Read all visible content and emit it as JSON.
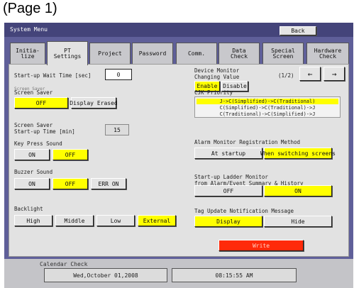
{
  "caption": "(Page 1)",
  "header": {
    "system_menu": "System Menu",
    "back_label": "Back"
  },
  "tabs": [
    {
      "label": "Initia-\nlize",
      "active": false
    },
    {
      "label": "PT\nSettings",
      "active": true
    },
    {
      "label": "Project",
      "active": false
    },
    {
      "label": "Password",
      "active": false
    },
    {
      "label": "Comm.",
      "active": false
    },
    {
      "label": "Data\nCheck",
      "active": false
    },
    {
      "label": "Special\nScreen",
      "active": false
    },
    {
      "label": "Hardware\nCheck",
      "active": false
    }
  ],
  "startup_wait": {
    "label": "Start-up Wait Time [sec]",
    "value": "0"
  },
  "screen_saver": {
    "label_faded": "Screen Saver",
    "label": "Screen Saver",
    "off": "OFF",
    "display_erased": "Display Erased",
    "startup_label": "Screen Saver\nStart-up Time [min]",
    "startup_value": "15"
  },
  "key_press_sound": {
    "label": "Key Press Sound",
    "on": "ON",
    "off": "OFF"
  },
  "buzzer_sound": {
    "label": "Buzzer Sound",
    "on": "ON",
    "off": "OFF",
    "err_on": "ERR ON"
  },
  "backlight": {
    "label": "Backlight",
    "high": "High",
    "middle": "Middle",
    "low": "Low",
    "external": "External"
  },
  "device_monitor": {
    "label": "Device Monitor\nChanging Value",
    "enable": "Enable",
    "disable": "Disable"
  },
  "pager": {
    "text": "(1/2)",
    "prev": "←",
    "next": "→"
  },
  "cjk_priority": {
    "label": "CJK Priority",
    "options": [
      "J->C(Simplified)->C(Traditional)",
      "C(Simplified)->C(Traditional)->J",
      "C(Traditional)->C(Simplified)->J"
    ],
    "selected_index": 0
  },
  "alarm_monitor": {
    "label": "Alarm Monitor Registration Method",
    "at_startup": "At startup",
    "when_switching": "When switching screens"
  },
  "ladder_monitor": {
    "label": "Start-up Ladder Monitor\nfrom Alarm/Event Summary & History",
    "off": "OFF",
    "on": "ON"
  },
  "tag_update": {
    "label": "Tag Update Notification Message",
    "display": "Display",
    "hide": "Hide"
  },
  "write_button": "Write",
  "calendar": {
    "label": "Calendar Check",
    "date": "Wed,October 01,2008",
    "time": "08:15:55 AM"
  },
  "colors": {
    "selected": "#ffff00",
    "write": "#ff2a0a",
    "frame": "#5f5f99"
  }
}
